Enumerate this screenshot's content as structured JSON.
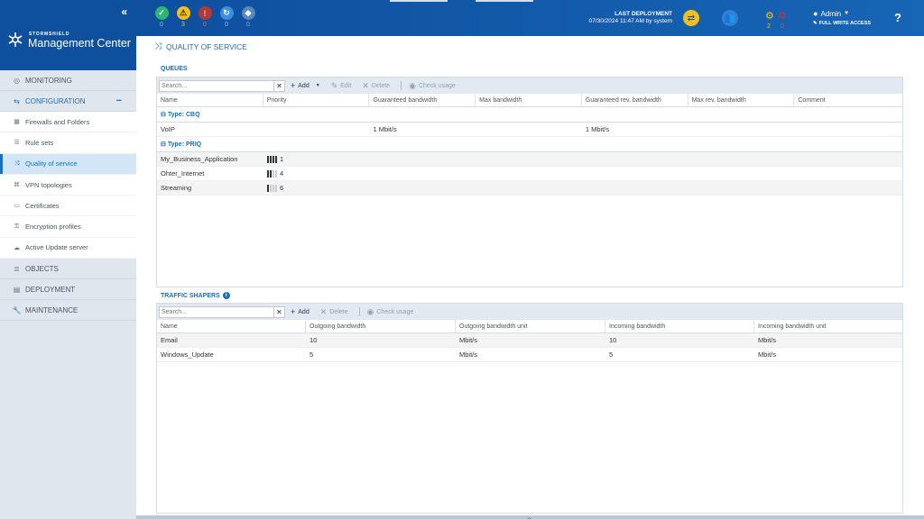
{
  "brand": {
    "small": "STORMSHIELD",
    "big": "Management Center",
    "collapse": "«"
  },
  "nav": {
    "monitoring": "MONITORING",
    "configuration": "CONFIGURATION",
    "config_items": [
      {
        "label": "Firewalls and Folders",
        "icon": "firewall-icon"
      },
      {
        "label": "Rule sets",
        "icon": "list-icon"
      },
      {
        "label": "Quality of service",
        "icon": "shuffle-icon",
        "active": true
      },
      {
        "label": "VPN topologies",
        "icon": "vpn-icon"
      },
      {
        "label": "Certificates",
        "icon": "certificate-icon"
      },
      {
        "label": "Encryption profiles",
        "icon": "key-icon"
      },
      {
        "label": "Active Update server",
        "icon": "cloud-icon"
      }
    ],
    "objects": "OBJECTS",
    "deployment": "DEPLOYMENT",
    "maintenance": "MAINTENANCE"
  },
  "topbar": {
    "status": [
      {
        "name": "ok",
        "count": "0",
        "color": "#2bb673",
        "glyph": "✓"
      },
      {
        "name": "warning",
        "count": "3",
        "color": "#f2c01d",
        "glyph": "!"
      },
      {
        "name": "critical",
        "count": "0",
        "color": "#c0392b",
        "glyph": "!"
      },
      {
        "name": "sync",
        "count": "0",
        "color": "#3b8ee5",
        "glyph": "↻"
      },
      {
        "name": "offline",
        "count": "0",
        "color": "#4a7bb5",
        "glyph": "◈"
      }
    ],
    "deploy_title": "LAST DEPLOYMENT",
    "deploy_info": "07/30/2024 11:47 AM by system",
    "alerts_warn": "2",
    "alerts_err": "0",
    "user": "Admin",
    "access": "FULL WRITE ACCESS",
    "help": "?"
  },
  "page": {
    "title": "QUALITY OF SERVICE"
  },
  "queues": {
    "title": "QUEUES",
    "search_placeholder": "Search...",
    "add": "Add",
    "edit": "Edit",
    "delete": "Delete",
    "check": "Check usage",
    "columns": [
      "Name",
      "Priority",
      "Guaranteed bandwidth",
      "Max bandwidth",
      "Guaranteed rev. bandwidth",
      "Max rev. bandwidth",
      "Comment"
    ],
    "cbq_group": "Type: CBQ",
    "cbq_rows": [
      {
        "name": "VoIP",
        "guaranteed": "1 Mbit/s",
        "max": "",
        "grev": "1 Mbit/s",
        "mrev": "",
        "comment": ""
      }
    ],
    "priq_group": "Type: PRIQ",
    "priq_rows": [
      {
        "name": "My_Business_Application",
        "priority": "1",
        "level": 4
      },
      {
        "name": "Ohter_Internet",
        "priority": "4",
        "level": 2
      },
      {
        "name": "Streaming",
        "priority": "6",
        "level": 1
      }
    ]
  },
  "shapers": {
    "title": "TRAFFIC SHAPERS",
    "search_placeholder": "Search...",
    "add": "Add",
    "delete": "Delete",
    "check": "Check usage",
    "columns": [
      "Name",
      "Outgoing bandwidth",
      "Outgoing bandwidth unit",
      "Incoming bandwidth",
      "Incoming bandwidth unit"
    ],
    "rows": [
      {
        "name": "Email",
        "out": "10",
        "out_unit": "Mbit/s",
        "in": "10",
        "in_unit": "Mbit/s"
      },
      {
        "name": "Windows_Update",
        "out": "5",
        "out_unit": "Mbit/s",
        "in": "5",
        "in_unit": "Mbit/s"
      }
    ]
  }
}
